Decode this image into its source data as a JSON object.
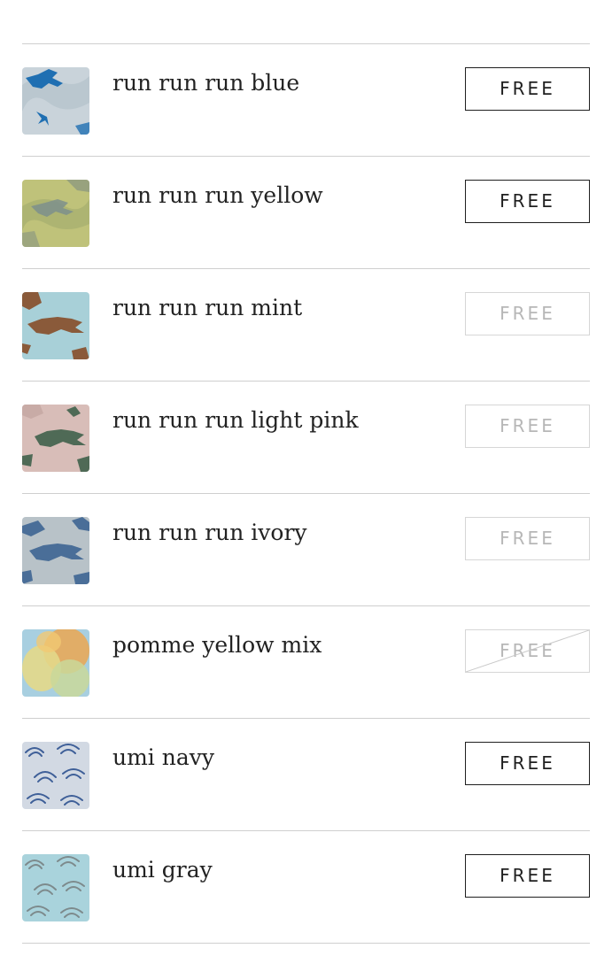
{
  "items": [
    {
      "name": "run run run blue",
      "button": "FREE",
      "state": "enabled",
      "icon": "rabbit-pattern-blue-swatch"
    },
    {
      "name": "run run run yellow",
      "button": "FREE",
      "state": "enabled",
      "icon": "rabbit-pattern-yellow-swatch"
    },
    {
      "name": "run run run mint",
      "button": "FREE",
      "state": "disabled",
      "icon": "rabbit-pattern-mint-swatch"
    },
    {
      "name": "run run run light pink",
      "button": "FREE",
      "state": "disabled",
      "icon": "rabbit-pattern-pink-swatch"
    },
    {
      "name": "run run run ivory",
      "button": "FREE",
      "state": "disabled",
      "icon": "rabbit-pattern-ivory-swatch"
    },
    {
      "name": "pomme yellow mix",
      "button": "FREE",
      "state": "sold-out",
      "icon": "apple-pattern-yellow-swatch"
    },
    {
      "name": "umi navy",
      "button": "FREE",
      "state": "enabled",
      "icon": "wave-pattern-navy-swatch"
    },
    {
      "name": "umi gray",
      "button": "FREE",
      "state": "enabled",
      "icon": "wave-pattern-gray-swatch"
    }
  ],
  "colors": {
    "divider": "#cfcfcf",
    "button_enabled": "#1f1f1f",
    "button_disabled": "#b7b7b7"
  }
}
